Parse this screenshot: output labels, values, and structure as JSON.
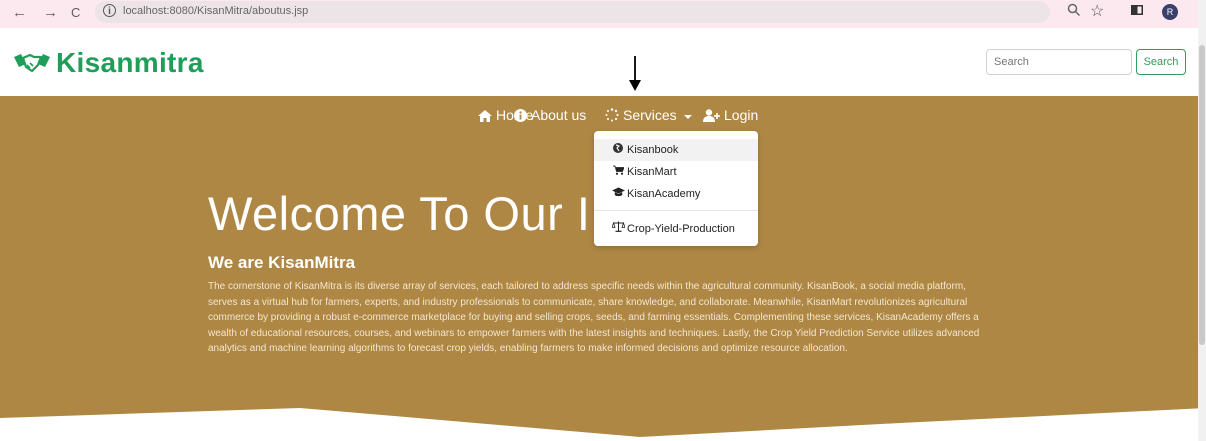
{
  "browser": {
    "url": "localhost:8080/KisanMitra/aboutus.jsp",
    "back_icon": "←",
    "forward_icon": "→",
    "reload_icon": "C",
    "info_icon": "i",
    "profile_initial": "R"
  },
  "header": {
    "brand": "Kisanmitra",
    "brand_color": "#1f9e5a",
    "search_placeholder": "Search",
    "search_button": "Search"
  },
  "nav": {
    "home": "Home",
    "about": "About us",
    "services": "Services",
    "login": "Login"
  },
  "services_menu": {
    "items": [
      "Kisanbook",
      "KisanMart",
      "KisanAcademy",
      "Crop-Yield-Production"
    ]
  },
  "hero": {
    "background": "#ae8745",
    "welcome": "Welcome To Our I",
    "subtitle": "We are KisanMitra",
    "paragraph": "The cornerstone of KisanMitra is its diverse array of services, each tailored to address specific needs within the agricultural community. KisanBook, a social media platform, serves as a virtual hub for farmers, experts, and industry professionals to communicate, share knowledge, and collaborate. Meanwhile, KisanMart revolutionizes agricultural commerce by providing a robust e-commerce marketplace for buying and selling crops, seeds, and farming essentials. Complementing these services, KisanAcademy offers a wealth of educational resources, courses, and webinars to empower farmers with the latest insights and techniques. Lastly, the Crop Yield Prediction Service utilizes advanced analytics and machine learning algorithms to forecast crop yields, enabling farmers to make informed decisions and optimize resource allocation."
  }
}
